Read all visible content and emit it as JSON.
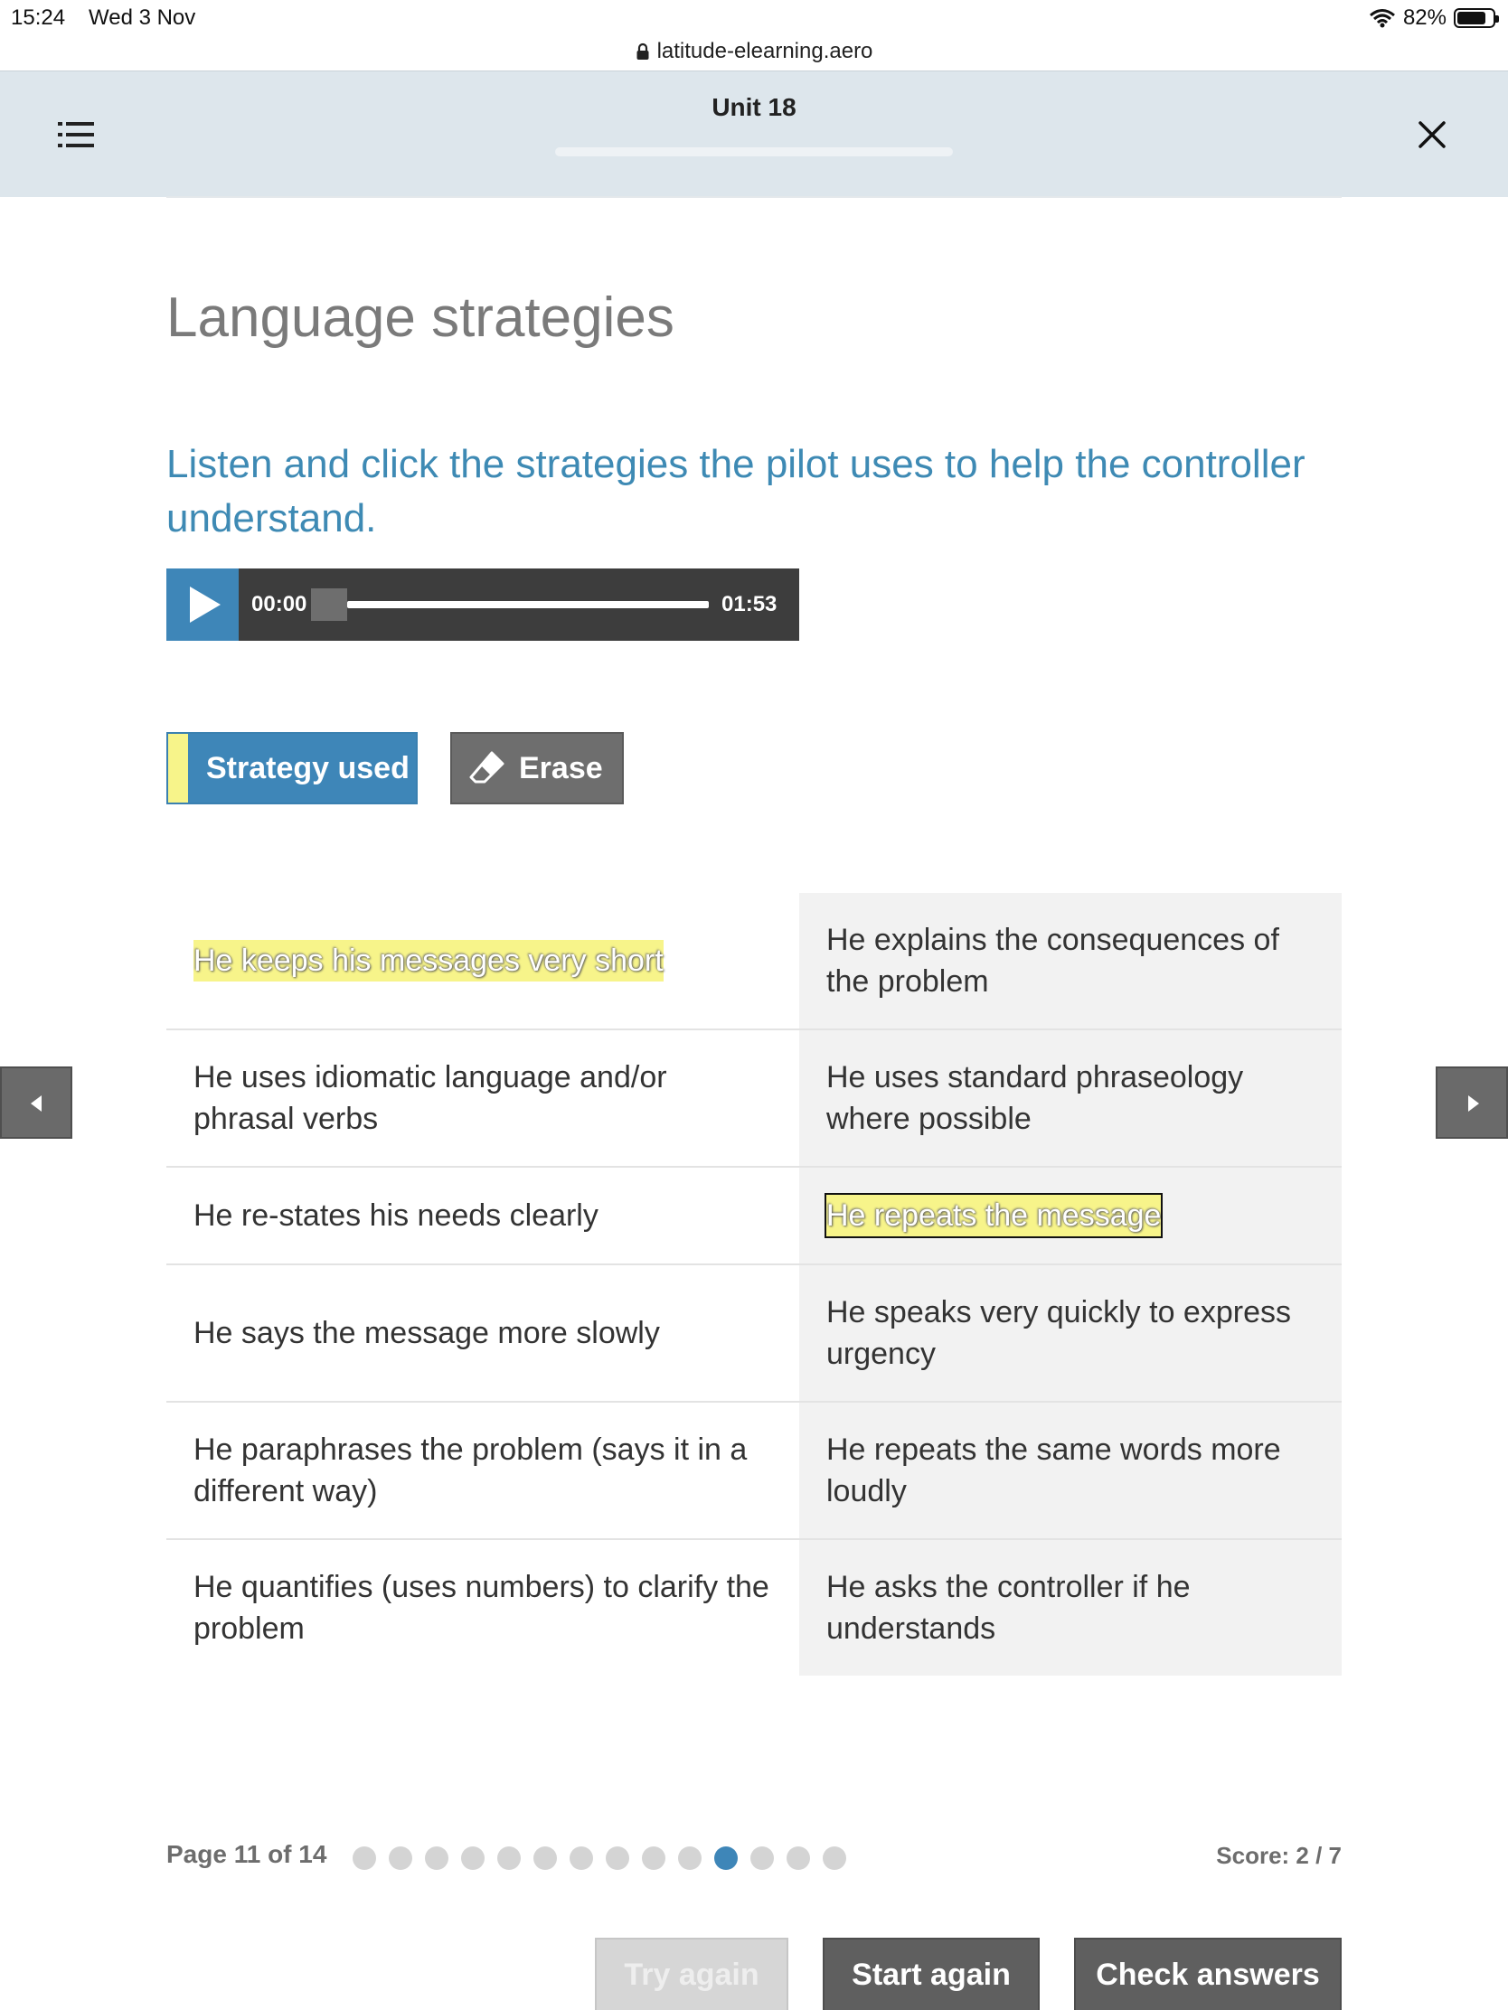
{
  "status_bar": {
    "time": "15:24",
    "date": "Wed 3 Nov",
    "battery": "82%",
    "battery_level": 0.82
  },
  "browser": {
    "url": "latitude-elearning.aero"
  },
  "header": {
    "unit_title": "Unit 18"
  },
  "page": {
    "title": "Language strategies",
    "instruction": "Listen and click the strategies the pilot uses to help the controller understand."
  },
  "audio": {
    "current_time": "00:00",
    "total_time": "01:53",
    "progress": 0
  },
  "tools": {
    "strategy_label": "Strategy used",
    "erase_label": "Erase",
    "highlight_color": "#f7f48a"
  },
  "strategies": [
    {
      "left": "He keeps his messages very short",
      "left_selected": true,
      "right": "He explains the consequences of the problem",
      "right_selected": false
    },
    {
      "left": "He uses idiomatic language and/or phrasal verbs",
      "left_selected": false,
      "right": "He uses standard phraseology where possible",
      "right_selected": false
    },
    {
      "left": "He re-states his needs clearly",
      "left_selected": false,
      "right": "He repeats the message",
      "right_selected": true
    },
    {
      "left": "He says the message more slowly",
      "left_selected": false,
      "right": "He speaks very quickly to express urgency",
      "right_selected": false
    },
    {
      "left": "He paraphrases the problem (says it in a different way)",
      "left_selected": false,
      "right": "He repeats the same words more loudly",
      "right_selected": false
    },
    {
      "left": "He quantifies (uses numbers) to clarify the problem",
      "left_selected": false,
      "right": "He asks the controller if he understands",
      "right_selected": false
    }
  ],
  "pager": {
    "label": "Page 11 of 14",
    "current": 11,
    "total": 14,
    "accent": "#3e86b8"
  },
  "score": {
    "label": "Score: 2 / 7"
  },
  "actions": {
    "try_again": "Try again",
    "start_again": "Start again",
    "check_answers": "Check answers"
  },
  "icons": {
    "menu": "list-icon",
    "close": "close-icon",
    "play": "play-icon",
    "erase": "eraser-icon",
    "prev": "arrow-left-icon",
    "next": "arrow-right-icon",
    "lock": "lock-icon",
    "wifi": "wifi-icon",
    "battery": "battery-icon"
  }
}
